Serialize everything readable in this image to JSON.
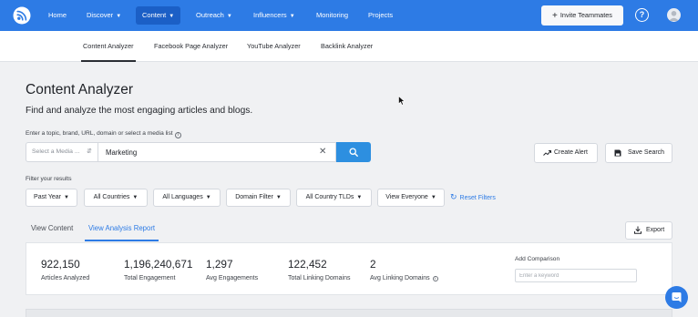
{
  "nav": {
    "items": [
      {
        "label": "Home",
        "caret": false
      },
      {
        "label": "Discover",
        "caret": true
      },
      {
        "label": "Content",
        "caret": true,
        "active": true
      },
      {
        "label": "Outreach",
        "caret": true
      },
      {
        "label": "Influencers",
        "caret": true
      },
      {
        "label": "Monitoring",
        "caret": false
      },
      {
        "label": "Projects",
        "caret": false
      }
    ],
    "invite_label": "Invite Teammates",
    "help_glyph": "?"
  },
  "subnav": {
    "items": [
      "Content Analyzer",
      "Facebook Page Analyzer",
      "YouTube Analyzer",
      "Backlink Analyzer"
    ],
    "active": "Content Analyzer"
  },
  "page": {
    "title": "Content Analyzer",
    "subtitle": "Find and analyze the most engaging articles and blogs."
  },
  "search": {
    "label": "Enter a topic, brand, URL, domain or select a media list",
    "media_placeholder": "Select a Media ...",
    "query_value": "Marketing",
    "create_alert_label": "Create Alert",
    "save_search_label": "Save Search"
  },
  "filters": {
    "label": "Filter your results",
    "items": [
      "Past Year",
      "All Countries",
      "All Languages",
      "Domain Filter",
      "All Country TLDs",
      "View Everyone"
    ],
    "reset_label": "Reset Filters"
  },
  "tabs": {
    "view_content": "View Content",
    "view_analysis": "View Analysis Report",
    "export_label": "Export"
  },
  "stats": [
    {
      "value": "922,150",
      "label": "Articles Analyzed"
    },
    {
      "value": "1,196,240,671",
      "label": "Total Engagement"
    },
    {
      "value": "1,297",
      "label": "Avg Engagements"
    },
    {
      "value": "122,452",
      "label": "Total Linking Domains"
    },
    {
      "value": "2",
      "label": "Avg Linking Domains"
    }
  ],
  "compare": {
    "label": "Add Comparison",
    "placeholder": "Enter a keyword"
  },
  "colors": {
    "brand": "#2d7be5",
    "nav_active": "#1b5fc6",
    "search_button": "#2d8fe0"
  }
}
